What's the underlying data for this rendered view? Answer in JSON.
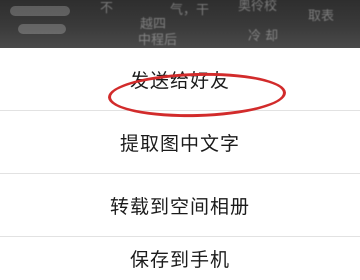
{
  "background_page": {
    "text_fragments": [
      "不",
      "取表",
      "气，干",
      "奥彾校",
      "冷 却",
      "越四",
      "中程后"
    ]
  },
  "share_menu": {
    "items": [
      {
        "label": "发送给好友"
      },
      {
        "label": "提取图中文字"
      },
      {
        "label": "转载到空间相册"
      },
      {
        "label": "保存到手机"
      }
    ]
  },
  "annotation": {
    "color": "#d22b2b"
  },
  "colors": {
    "sheet_bg": "#ffffff",
    "text": "#1b1b1b",
    "divider": "#e2e2e2"
  }
}
